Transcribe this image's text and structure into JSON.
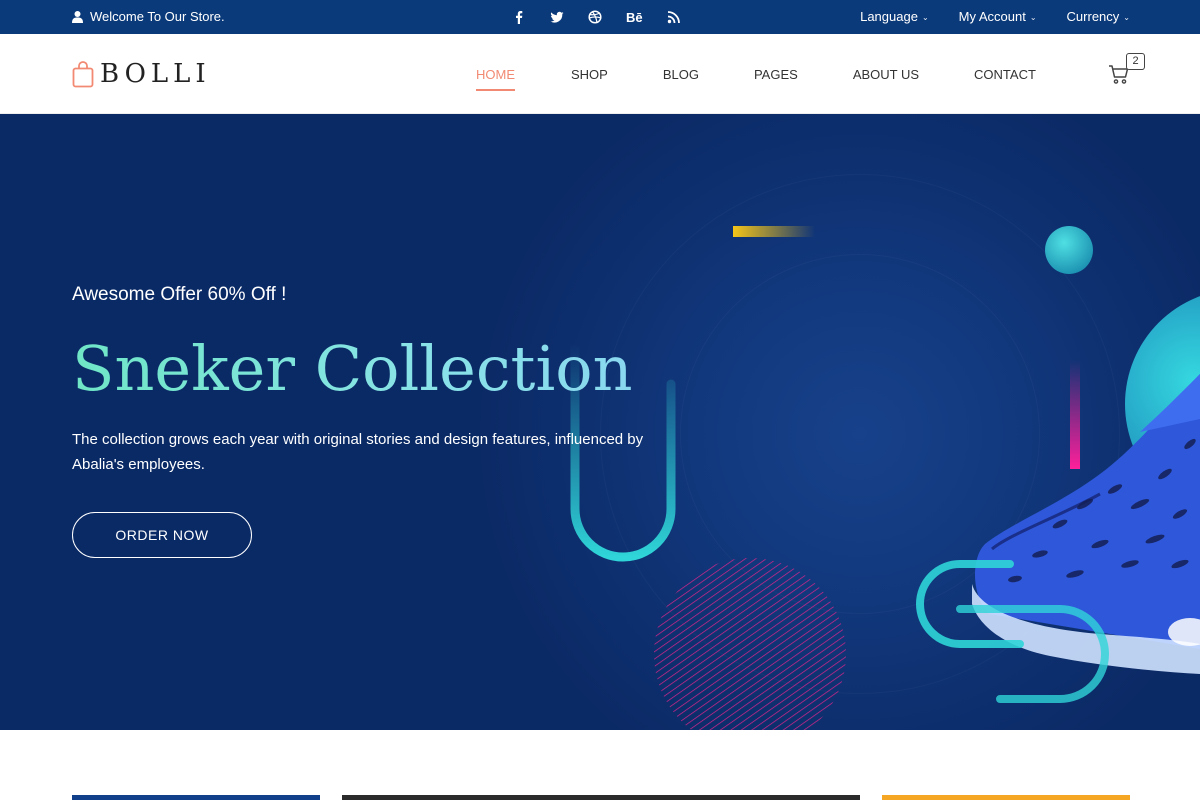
{
  "topbar": {
    "welcome": "Welcome To Our Store.",
    "social": [
      "facebook-icon",
      "twitter-icon",
      "dribbble-icon",
      "behance-icon",
      "rss-icon"
    ],
    "behance_text": "Bē",
    "language": "Language",
    "account": "My Account",
    "currency": "Currency"
  },
  "header": {
    "logo_text": "BOLLI",
    "nav": [
      "HOME",
      "SHOP",
      "BLOG",
      "PAGES",
      "ABOUT US",
      "CONTACT"
    ],
    "active_nav": "HOME",
    "cart_count": "2"
  },
  "hero": {
    "offer": "Awesome Offer 60% Off !",
    "title": "Sneker Collection",
    "description": "The collection grows each year with original stories and design features, influenced by Abalia's employees.",
    "button": "ORDER NOW"
  },
  "colors": {
    "topbar": "#0b3a7a",
    "hero_bg": "#0a2a66",
    "accent": "#f28a73",
    "teal": "#2fd5d8",
    "magenta": "#e0197d",
    "yellow": "#f5c518"
  }
}
